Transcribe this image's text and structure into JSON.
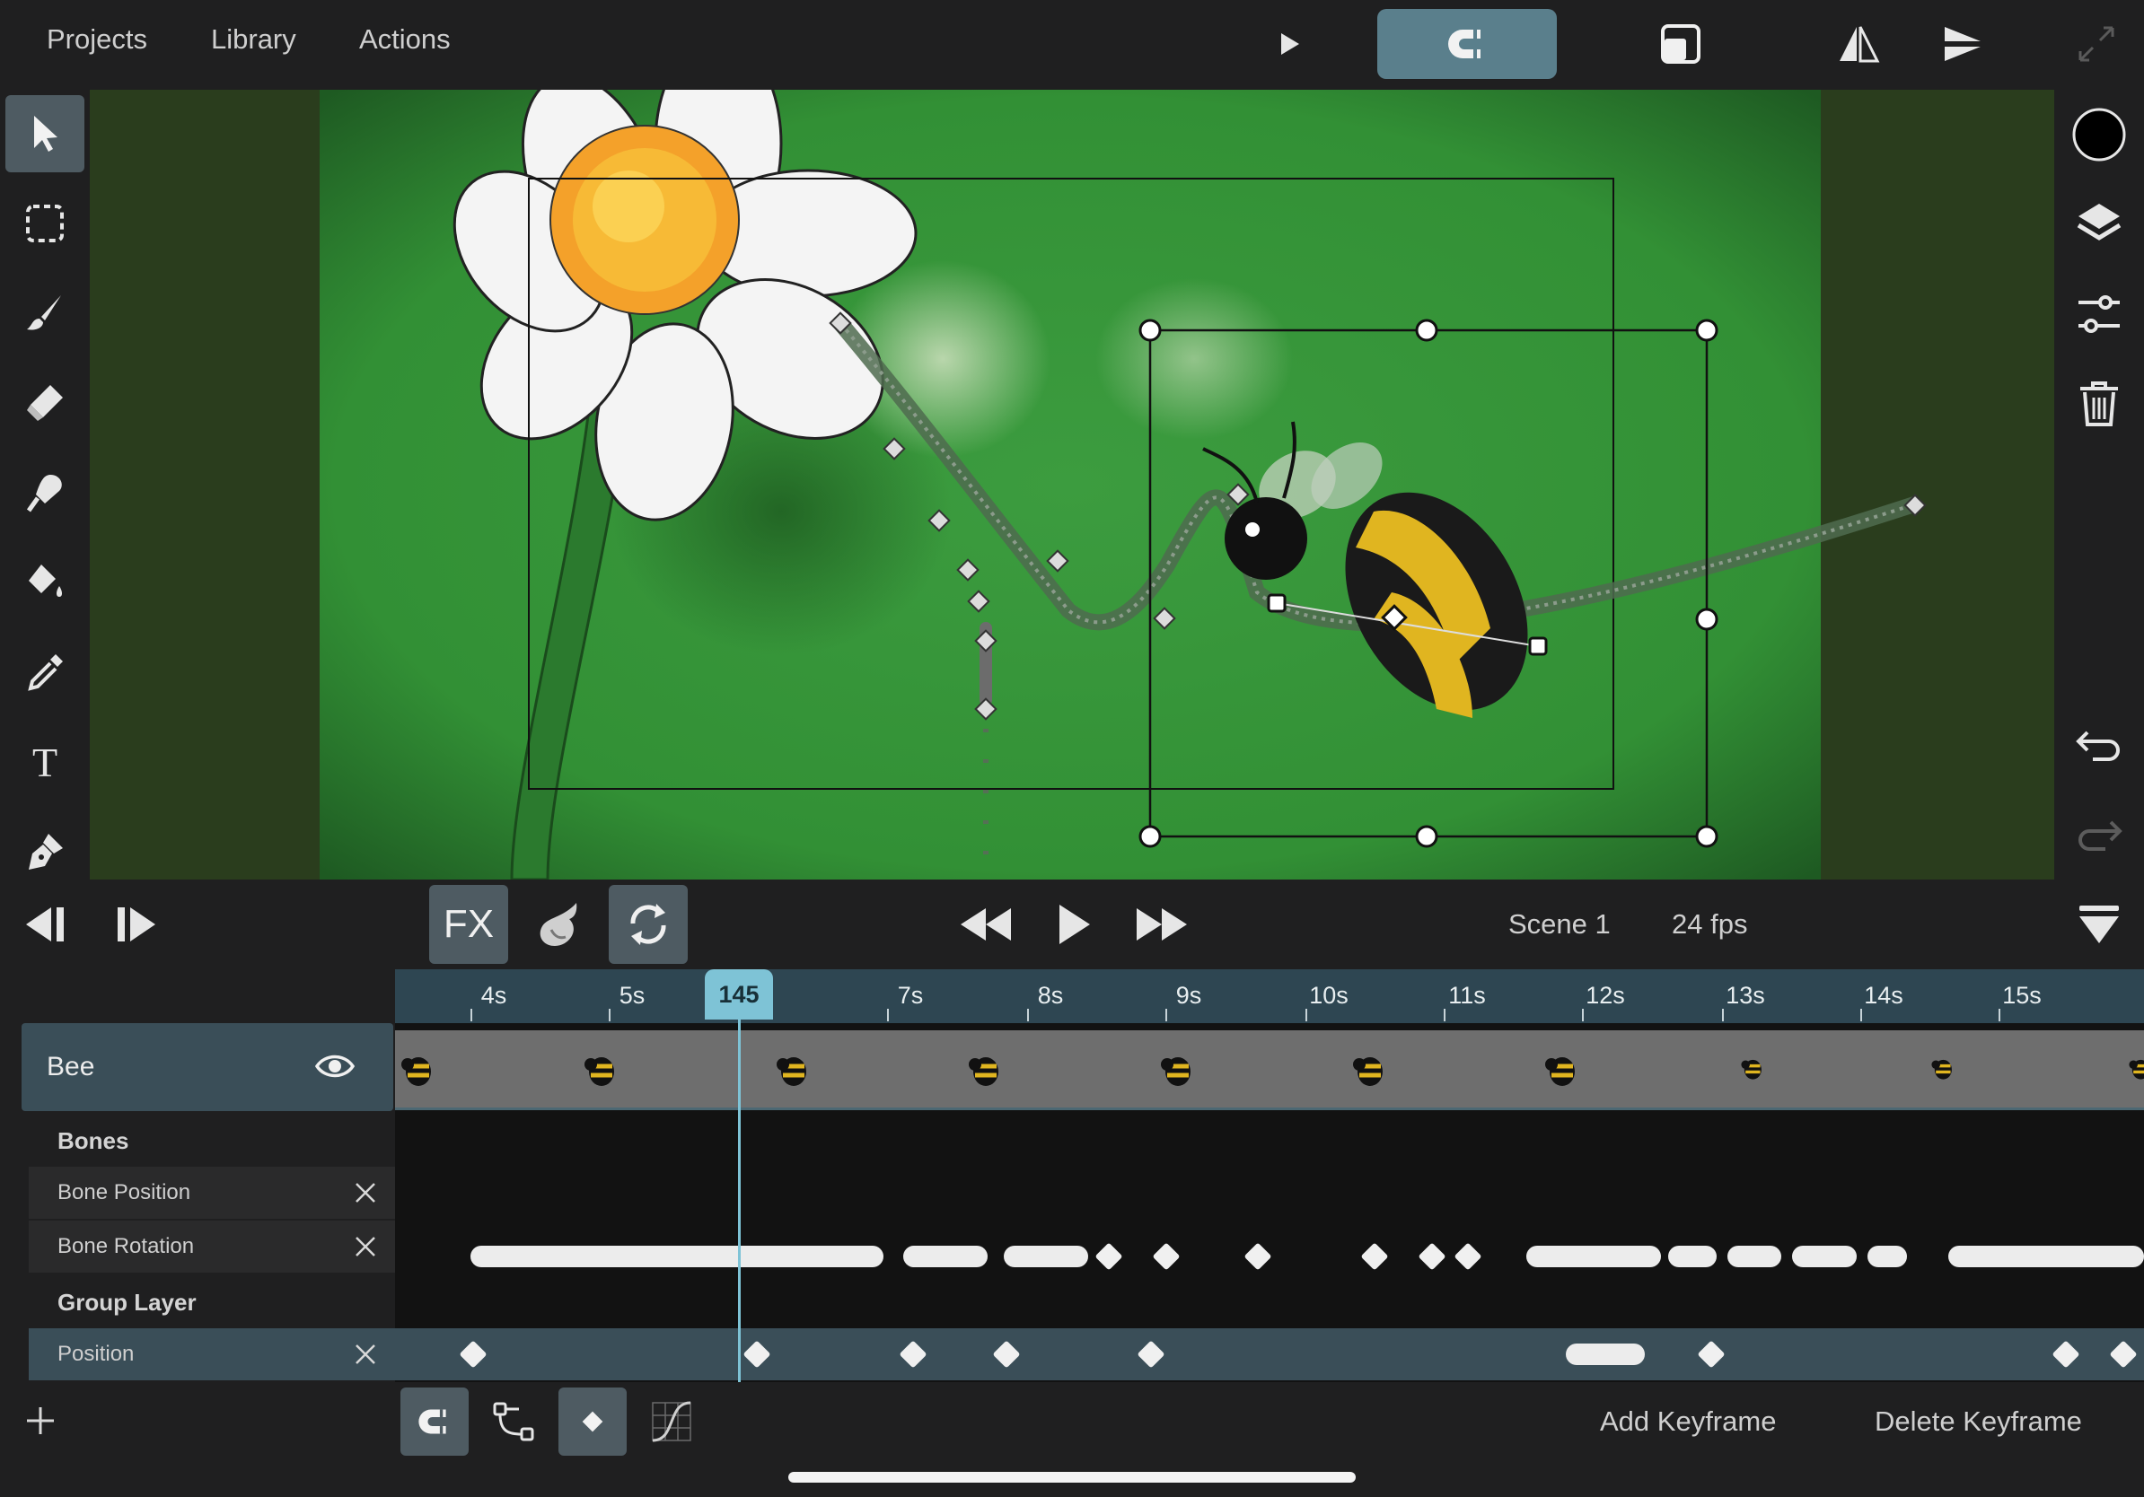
{
  "menu": {
    "projects": "Projects",
    "library": "Library",
    "actions": "Actions"
  },
  "icons": {
    "top": [
      "play-icon",
      "magnet-icon",
      "onion-square-icon",
      "flip-horizontal-icon",
      "flip-vertical-icon",
      "expand-icon"
    ],
    "tools": [
      "select-arrow-icon",
      "marquee-select-icon",
      "brush-icon",
      "eraser-icon",
      "smudge-icon",
      "fill-bucket-icon",
      "eyedropper-icon",
      "text-icon",
      "pen-icon"
    ],
    "right": [
      "color-swatch-icon",
      "layers-icon",
      "adjustments-icon",
      "trash-icon",
      "undo-icon",
      "redo-icon"
    ]
  },
  "colors": {
    "accent": "#5a7f8c",
    "ruler": "#2e4652",
    "playhead": "#7ec3d6",
    "canvas_green": "#3a9a3e",
    "selected_swatch": "#000000"
  },
  "transport": {
    "fx_label": "FX",
    "scene": "Scene 1",
    "fps": "24 fps"
  },
  "timeline": {
    "current_frame": "145",
    "ticks": [
      "4s",
      "5s",
      "7s",
      "8s",
      "9s",
      "10s",
      "11s",
      "12s",
      "13s",
      "14s",
      "15s"
    ]
  },
  "layers": {
    "main_layer": "Bee",
    "bones_header": "Bones",
    "bone_position": "Bone Position",
    "bone_rotation": "Bone Rotation",
    "group_header": "Group Layer",
    "position": "Position"
  },
  "bottom": {
    "add_keyframe": "Add Keyframe",
    "delete_keyframe": "Delete Keyframe"
  }
}
